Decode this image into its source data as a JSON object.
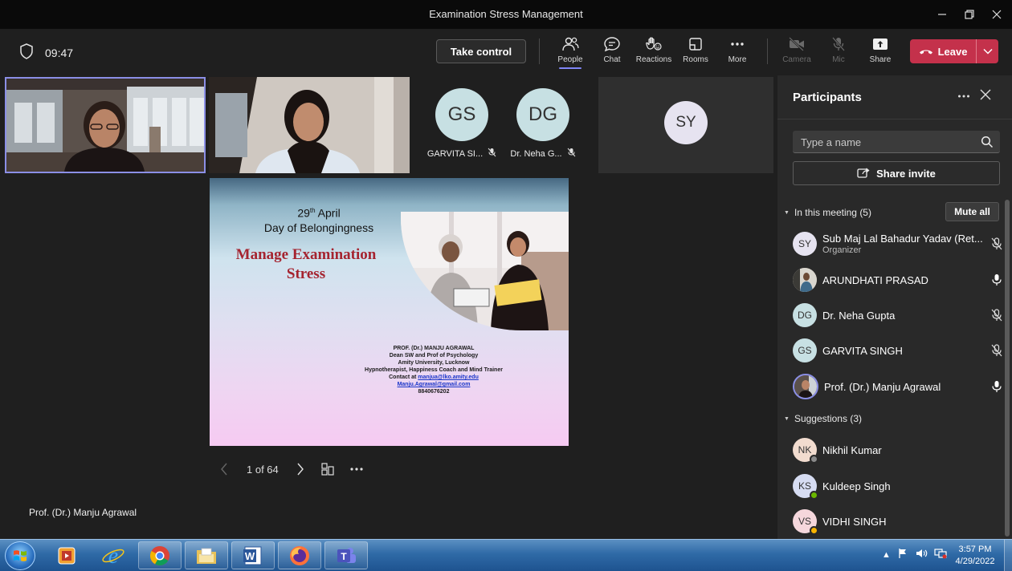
{
  "window": {
    "title": "Examination Stress Management"
  },
  "toolbar": {
    "timer": "09:47",
    "take_control_label": "Take control",
    "people_label": "People",
    "chat_label": "Chat",
    "reactions_label": "Reactions",
    "rooms_label": "Rooms",
    "more_label": "More",
    "camera_label": "Camera",
    "mic_label": "Mic",
    "share_label": "Share",
    "leave_label": "Leave",
    "leave_color": "#c4314b",
    "accent_color": "#7f85f5"
  },
  "stage": {
    "tiles": [
      {
        "initials": "GS",
        "name": "GARVITA SI...",
        "muted": true
      },
      {
        "initials": "DG",
        "name": "Dr. Neha G...",
        "muted": true
      },
      {
        "initials": "SY"
      }
    ],
    "presenter_name": "Prof. (Dr.) Manju Agrawal"
  },
  "slide": {
    "date_day": "29",
    "date_sup": "th",
    "date_month": " April",
    "event": "Day of Belongingness",
    "title_line1": "Manage Examination",
    "title_line2": "Stress",
    "contact_lines": [
      "PROF. (Dr.) MANJU AGRAWAL",
      "Dean SW and Prof of Psychology",
      "Amity University, Lucknow",
      "Hypnotherapist, Happiness Coach and Mind Trainer"
    ],
    "contact_prefix": "Contact at ",
    "email1": "manjua@lko.amity.edu",
    "email2": "Manju.Agrawal@gmail.com",
    "phone": "8840676202"
  },
  "slide_nav": {
    "page_text": "1 of 64"
  },
  "panel": {
    "title": "Participants",
    "search_placeholder": "Type a name",
    "share_invite_label": "Share invite",
    "in_meeting_label": "In this meeting (5)",
    "mute_all_label": "Mute all",
    "participants": [
      {
        "initials": "SY",
        "name": "Sub Maj Lal Bahadur Yadav (Ret...",
        "role": "Organizer",
        "mic": "muted",
        "avatar_color": "#e6e3f0"
      },
      {
        "initials": "",
        "name": "ARUNDHATI PRASAD",
        "mic": "on",
        "avatar_color": "#8a7b6a"
      },
      {
        "initials": "DG",
        "name": "Dr. Neha Gupta",
        "mic": "muted",
        "avatar_color": "#c7e0e3"
      },
      {
        "initials": "GS",
        "name": "GARVITA SINGH",
        "mic": "muted",
        "avatar_color": "#c7e0e3"
      },
      {
        "initials": "",
        "name": "Prof. (Dr.) Manju Agrawal",
        "mic": "on",
        "avatar_color": "#6b6560"
      }
    ],
    "suggestions_label": "Suggestions (3)",
    "suggestions": [
      {
        "initials": "NK",
        "name": "Nikhil Kumar",
        "status": "offline",
        "avatar_color": "#f2dccf"
      },
      {
        "initials": "KS",
        "name": "Kuldeep Singh",
        "status": "available",
        "avatar_color": "#d6dcf2"
      },
      {
        "initials": "VS",
        "name": "VIDHI SINGH",
        "status": "away",
        "avatar_color": "#f5d7dc"
      }
    ]
  },
  "taskbar": {
    "clock_time": "3:57 PM",
    "clock_date": "4/29/2022",
    "apps": [
      "media-player-icon",
      "internet-explorer-icon",
      "chrome-icon",
      "file-explorer-icon",
      "word-icon",
      "firefox-icon",
      "teams-icon"
    ]
  }
}
